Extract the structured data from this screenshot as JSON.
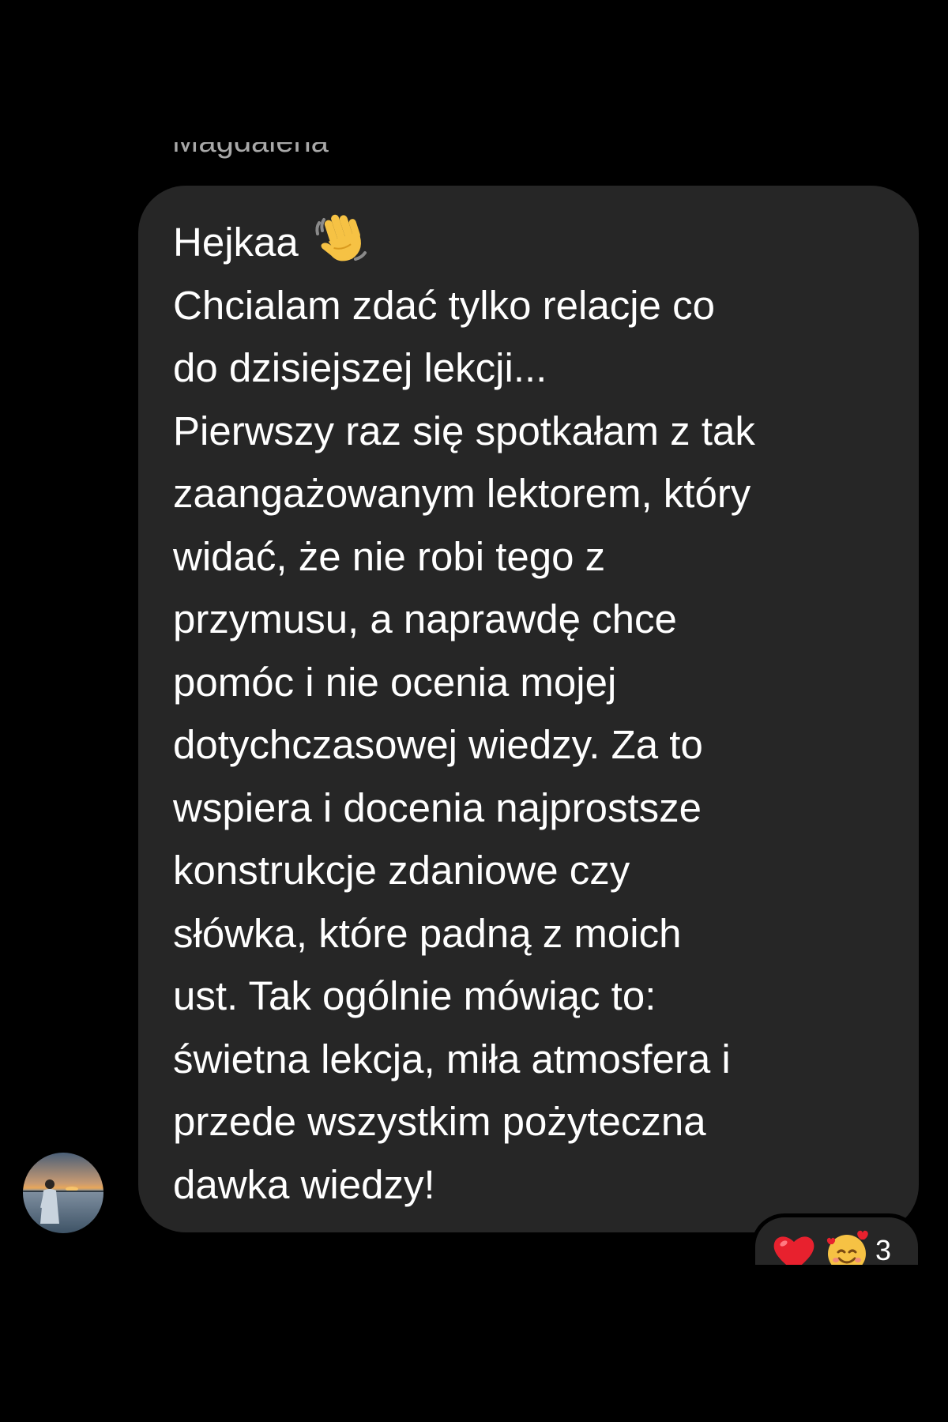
{
  "conversation": {
    "sender_name": "Magdalena"
  },
  "message": {
    "lines": [
      "Hejkaa",
      "Chcialam zdać tylko relacje co",
      "do dzisiejszej lekcji...",
      "Pierwszy raz się spotkałam z tak",
      "zaangażowanym lektorem, który",
      "widać, że nie robi tego z",
      "przymusu, a naprawdę chce",
      "pomóc i nie ocenia mojej",
      "dotychczasowej wiedzy. Za to",
      "wspiera i docenia najprostsze",
      "konstrukcje zdaniowe czy",
      "słówka, które padną z moich",
      "ust. Tak ogólnie mówiąc to:",
      "świetna lekcja, miła atmosfera i",
      "przede wszystkim pożyteczna",
      "dawka wiedzy!"
    ],
    "emoji": "waving-hand-icon"
  },
  "reactions": {
    "emojis": [
      "red-heart-icon",
      "smiling-face-with-hearts-icon"
    ],
    "count": "3"
  },
  "colors": {
    "background": "#000000",
    "bubble": "#262626",
    "text": "#ffffff",
    "sender_name": "#a8a8a8"
  }
}
